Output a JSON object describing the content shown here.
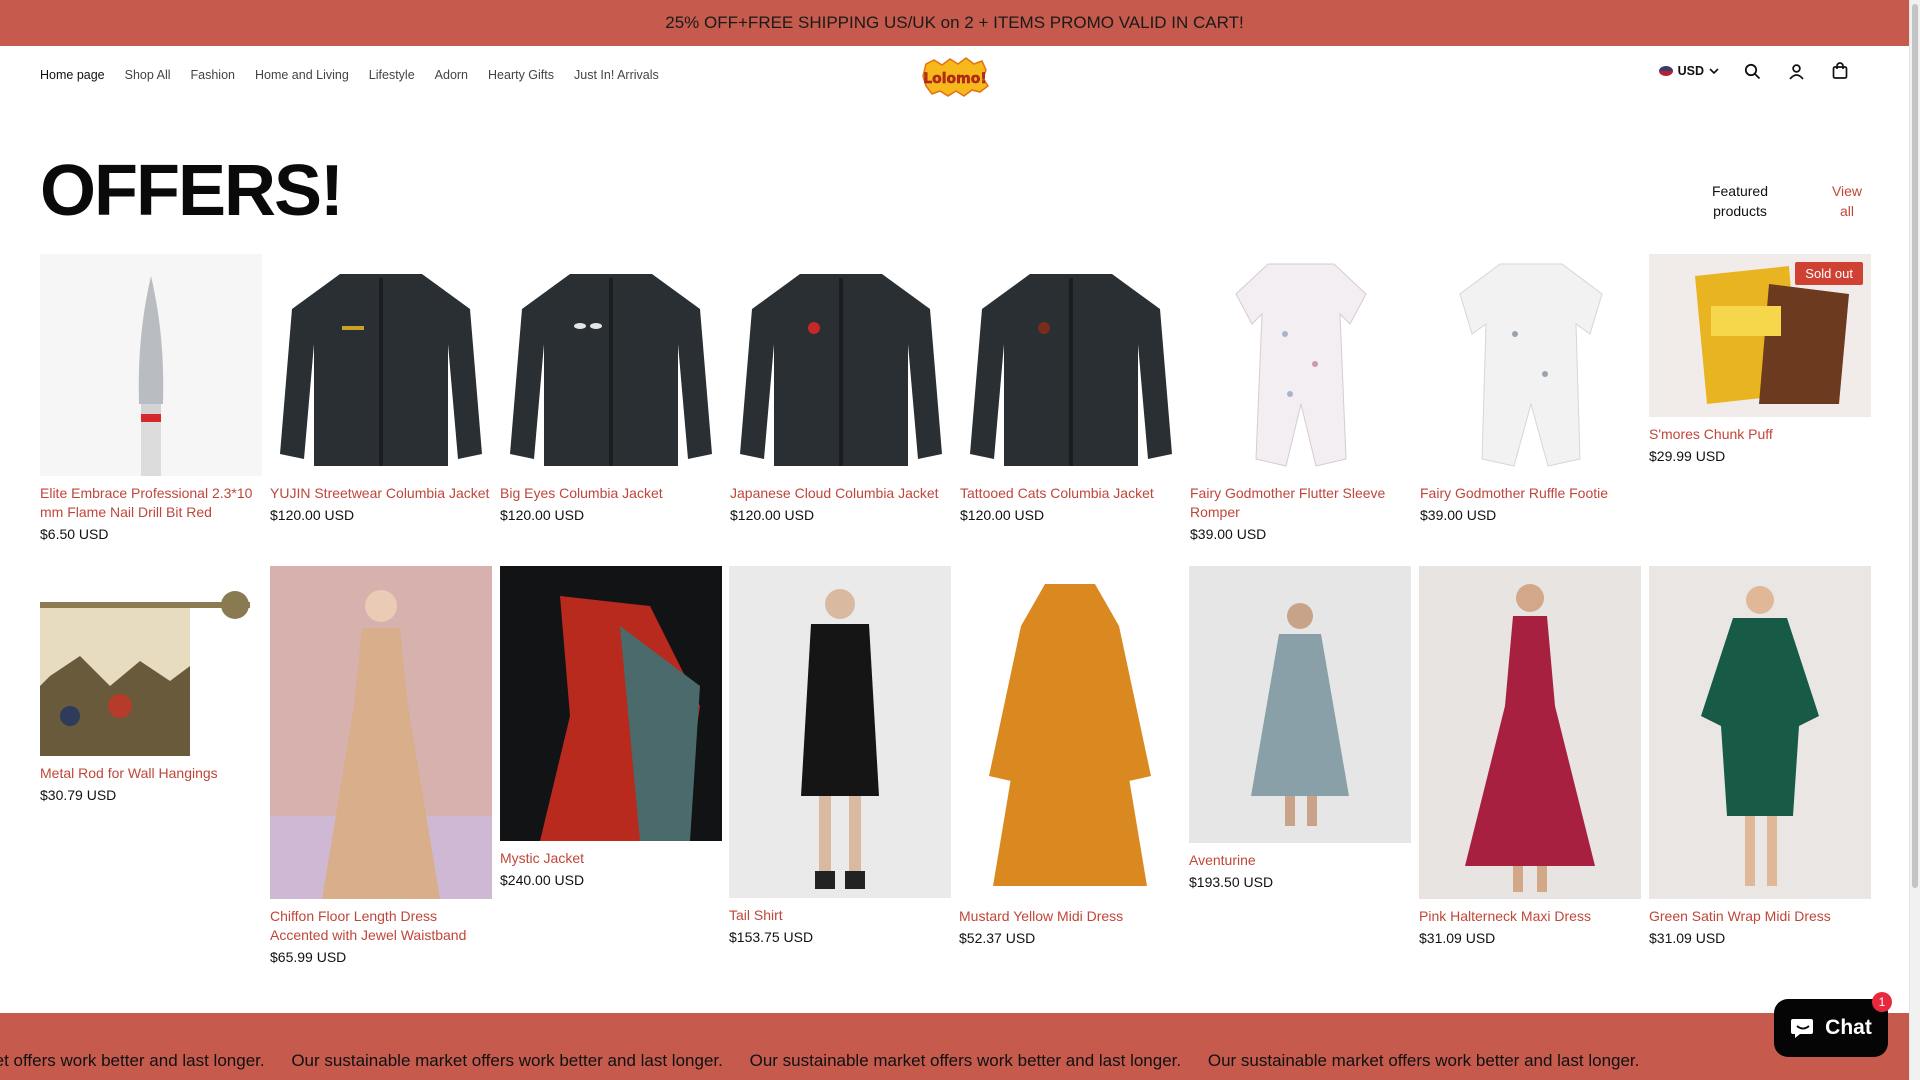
{
  "announcement": "25% OFF+FREE SHIPPING US/UK on 2 + ITEMS PROMO VALID IN CART!",
  "nav": [
    "Home page",
    "Shop All",
    "Fashion",
    "Home and Living",
    "Lifestyle",
    "Adorn",
    "Hearty Gifts",
    "Just In! Arrivals"
  ],
  "logo_text": "Lolomo!",
  "currency": "USD",
  "icons": {
    "search": "search-icon",
    "account": "user-icon",
    "cart": "bag-icon",
    "currency_flag": "us-flag-icon"
  },
  "heading": "OFFERS!",
  "featured_label": "Featured products",
  "view_all": "View all",
  "products": [
    {
      "title": "Elite Embrace Professional 2.3*10 mm Flame Nail Drill Bit Red",
      "price": "$6.50 USD"
    },
    {
      "title": "YUJIN Streetwear Columbia Jacket",
      "price": "$120.00 USD"
    },
    {
      "title": "Big Eyes Columbia Jacket",
      "price": "$120.00 USD"
    },
    {
      "title": "Japanese Cloud Columbia Jacket",
      "price": "$120.00 USD"
    },
    {
      "title": "Tattooed Cats Columbia Jacket",
      "price": "$120.00 USD"
    },
    {
      "title": "Fairy Godmother Flutter Sleeve Romper",
      "price": "$39.00 USD"
    },
    {
      "title": "Fairy Godmother Ruffle Footie",
      "price": "$39.00 USD"
    },
    {
      "title": "S'mores Chunk Puff",
      "price": "$29.99 USD",
      "badge": "Sold out"
    },
    {
      "title": "Metal Rod for Wall Hangings",
      "price": "$30.79 USD"
    },
    {
      "title": "Chiffon Floor Length Dress Accented with Jewel Waistband",
      "price": "$65.99 USD"
    },
    {
      "title": "Mystic Jacket",
      "price": "$240.00 USD"
    },
    {
      "title": "Tail Shirt",
      "price": "$153.75 USD"
    },
    {
      "title": "Mustard Yellow Midi Dress",
      "price": "$52.37 USD"
    },
    {
      "title": "Aventurine",
      "price": "$193.50 USD"
    },
    {
      "title": "Pink Halterneck Maxi Dress",
      "price": "$31.09 USD"
    },
    {
      "title": "Green Satin Wrap Midi Dress",
      "price": "$31.09 USD"
    }
  ],
  "marquee": [
    "able market offers work better and last longer.",
    "Our sustainable market offers work better and last longer.",
    "Our sustainable market offers work better and last longer.",
    "Our sustainable market offers work better and last longer."
  ],
  "chat_label": "Chat",
  "chat_count": "1",
  "colors": {
    "brand": "#c55a4d",
    "link": "#c0463a",
    "badge": "#cf4233"
  }
}
